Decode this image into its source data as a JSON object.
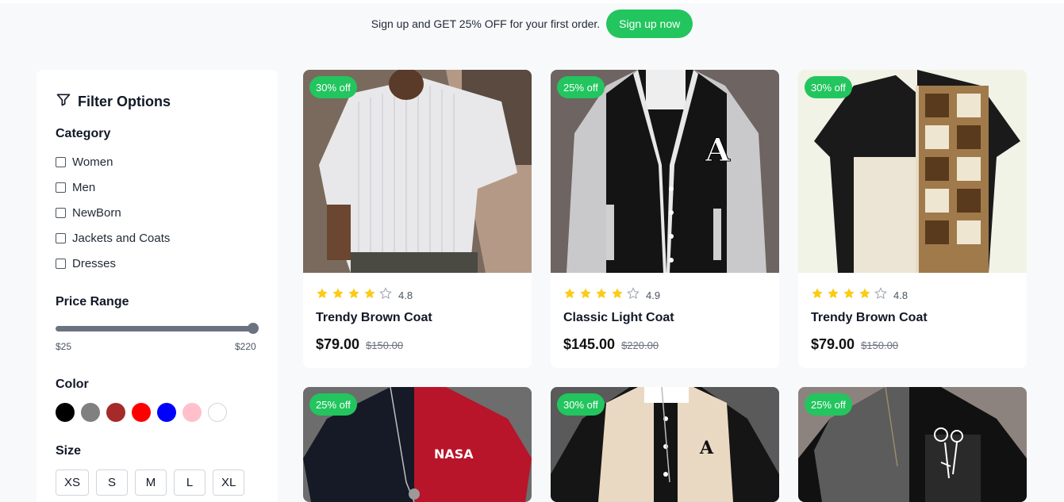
{
  "banner": {
    "text": "Sign up and GET 25% OFF for your first order.",
    "cta_label": "Sign up now",
    "accent": "#22c55e"
  },
  "filters": {
    "title": "Filter Options",
    "category_label": "Category",
    "categories": [
      "Women",
      "Men",
      "NewBorn",
      "Jackets and Coats",
      "Dresses"
    ],
    "price_label": "Price Range",
    "price_min": "$25",
    "price_max": "$220",
    "color_label": "Color",
    "colors": [
      "#000000",
      "#808080",
      "#a52a2a",
      "#ff0000",
      "#0000ff",
      "#ffc0cb",
      "#ffffff"
    ],
    "size_label": "Size",
    "sizes": [
      "XS",
      "S",
      "M",
      "L",
      "XL"
    ]
  },
  "products": [
    {
      "badge": "30% off",
      "rating": "4.8",
      "stars": 4,
      "title": "Trendy Brown Coat",
      "price": "$79.00",
      "old_price": "$150.00",
      "image": "white-striped-shirt"
    },
    {
      "badge": "25% off",
      "rating": "4.9",
      "stars": 4,
      "title": "Classic Light Coat",
      "price": "$145.00",
      "old_price": "$220.00",
      "image": "varsity-jacket"
    },
    {
      "badge": "30% off",
      "rating": "4.8",
      "stars": 4,
      "title": "Trendy Brown Coat",
      "price": "$79.00",
      "old_price": "$150.00",
      "image": "patchwork-shirt"
    },
    {
      "badge": "25% off",
      "image": "nasa-tshirt",
      "print": "NASA"
    },
    {
      "badge": "30% off",
      "image": "baseball-jacket",
      "print": "A"
    },
    {
      "badge": "25% off",
      "image": "rose-pocket-tshirt"
    }
  ]
}
